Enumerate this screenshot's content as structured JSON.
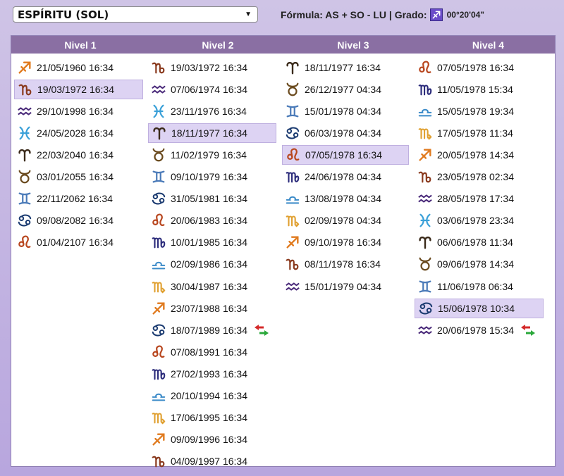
{
  "topbar": {
    "select_value": "ESPÍRITU (SOL)",
    "formula_text": "Fórmula: AS + SO - LU | Grado:",
    "grado_value": "00°20'04\""
  },
  "headers": [
    "Nivel 1",
    "Nivel 2",
    "Nivel 3",
    "Nivel 4"
  ],
  "colors": {
    "fire": "#e07a1e",
    "earth": "#8a3a1e",
    "air": "#4a2a7a",
    "water_pisces": "#3aa0d8",
    "water_cancer": "#1a3a70",
    "aries": "#3a2a1a",
    "taurus": "#6a4a1e",
    "gemini": "#4a7ab8",
    "leo": "#b8461e",
    "virgo": "#2a2a7a",
    "libra": "#3a8ac8",
    "scorpio": "#e0a030",
    "selected": "#ddd3f3",
    "header": "#8a6fa3"
  },
  "columns": [
    {
      "rows": [
        {
          "sign": "sagittarius",
          "date": "21/05/1960 16:34"
        },
        {
          "sign": "capricorn",
          "date": "19/03/1972 16:34",
          "selected": true
        },
        {
          "sign": "aquarius",
          "date": "29/10/1998 16:34"
        },
        {
          "sign": "pisces",
          "date": "24/05/2028 16:34"
        },
        {
          "sign": "aries",
          "date": "22/03/2040 16:34"
        },
        {
          "sign": "taurus",
          "date": "03/01/2055 16:34"
        },
        {
          "sign": "gemini",
          "date": "22/11/2062 16:34"
        },
        {
          "sign": "cancer",
          "date": "09/08/2082 16:34"
        },
        {
          "sign": "leo",
          "date": "01/04/2107 16:34"
        }
      ]
    },
    {
      "rows": [
        {
          "sign": "capricorn",
          "date": "19/03/1972 16:34"
        },
        {
          "sign": "aquarius",
          "date": "07/06/1974 16:34"
        },
        {
          "sign": "pisces",
          "date": "23/11/1976 16:34"
        },
        {
          "sign": "aries",
          "date": "18/11/1977 16:34",
          "selected": true
        },
        {
          "sign": "taurus",
          "date": "11/02/1979 16:34"
        },
        {
          "sign": "gemini",
          "date": "09/10/1979 16:34"
        },
        {
          "sign": "cancer",
          "date": "31/05/1981 16:34"
        },
        {
          "sign": "leo",
          "date": "20/06/1983 16:34"
        },
        {
          "sign": "virgo",
          "date": "10/01/1985 16:34"
        },
        {
          "sign": "libra",
          "date": "02/09/1986 16:34"
        },
        {
          "sign": "scorpio",
          "date": "30/04/1987 16:34"
        },
        {
          "sign": "sagittarius",
          "date": "23/07/1988 16:34"
        },
        {
          "sign": "cancer",
          "date": "18/07/1989 16:34",
          "swap": true
        },
        {
          "sign": "leo",
          "date": "07/08/1991 16:34"
        },
        {
          "sign": "virgo",
          "date": "27/02/1993 16:34"
        },
        {
          "sign": "libra",
          "date": "20/10/1994 16:34"
        },
        {
          "sign": "scorpio",
          "date": "17/06/1995 16:34"
        },
        {
          "sign": "sagittarius",
          "date": "09/09/1996 16:34"
        },
        {
          "sign": "capricorn",
          "date": "04/09/1997 16:34"
        }
      ]
    },
    {
      "rows": [
        {
          "sign": "aries",
          "date": "18/11/1977 16:34"
        },
        {
          "sign": "taurus",
          "date": "26/12/1977 04:34"
        },
        {
          "sign": "gemini",
          "date": "15/01/1978 04:34"
        },
        {
          "sign": "cancer",
          "date": "06/03/1978 04:34"
        },
        {
          "sign": "leo",
          "date": "07/05/1978 16:34",
          "selected": true
        },
        {
          "sign": "virgo",
          "date": "24/06/1978 04:34"
        },
        {
          "sign": "libra",
          "date": "13/08/1978 04:34"
        },
        {
          "sign": "scorpio",
          "date": "02/09/1978 04:34"
        },
        {
          "sign": "sagittarius",
          "date": "09/10/1978 16:34"
        },
        {
          "sign": "capricorn",
          "date": "08/11/1978 16:34"
        },
        {
          "sign": "aquarius",
          "date": "15/01/1979 04:34"
        }
      ]
    },
    {
      "rows": [
        {
          "sign": "leo",
          "date": "07/05/1978 16:34"
        },
        {
          "sign": "virgo",
          "date": "11/05/1978 15:34"
        },
        {
          "sign": "libra",
          "date": "15/05/1978 19:34"
        },
        {
          "sign": "scorpio",
          "date": "17/05/1978 11:34"
        },
        {
          "sign": "sagittarius",
          "date": "20/05/1978 14:34"
        },
        {
          "sign": "capricorn",
          "date": "23/05/1978 02:34"
        },
        {
          "sign": "aquarius",
          "date": "28/05/1978 17:34"
        },
        {
          "sign": "pisces",
          "date": "03/06/1978 23:34"
        },
        {
          "sign": "aries",
          "date": "06/06/1978 11:34"
        },
        {
          "sign": "taurus",
          "date": "09/06/1978 14:34"
        },
        {
          "sign": "gemini",
          "date": "11/06/1978 06:34"
        },
        {
          "sign": "cancer",
          "date": "15/06/1978 10:34",
          "selected": true
        },
        {
          "sign": "aquarius",
          "date": "20/06/1978 15:34",
          "swap": true
        }
      ]
    }
  ]
}
